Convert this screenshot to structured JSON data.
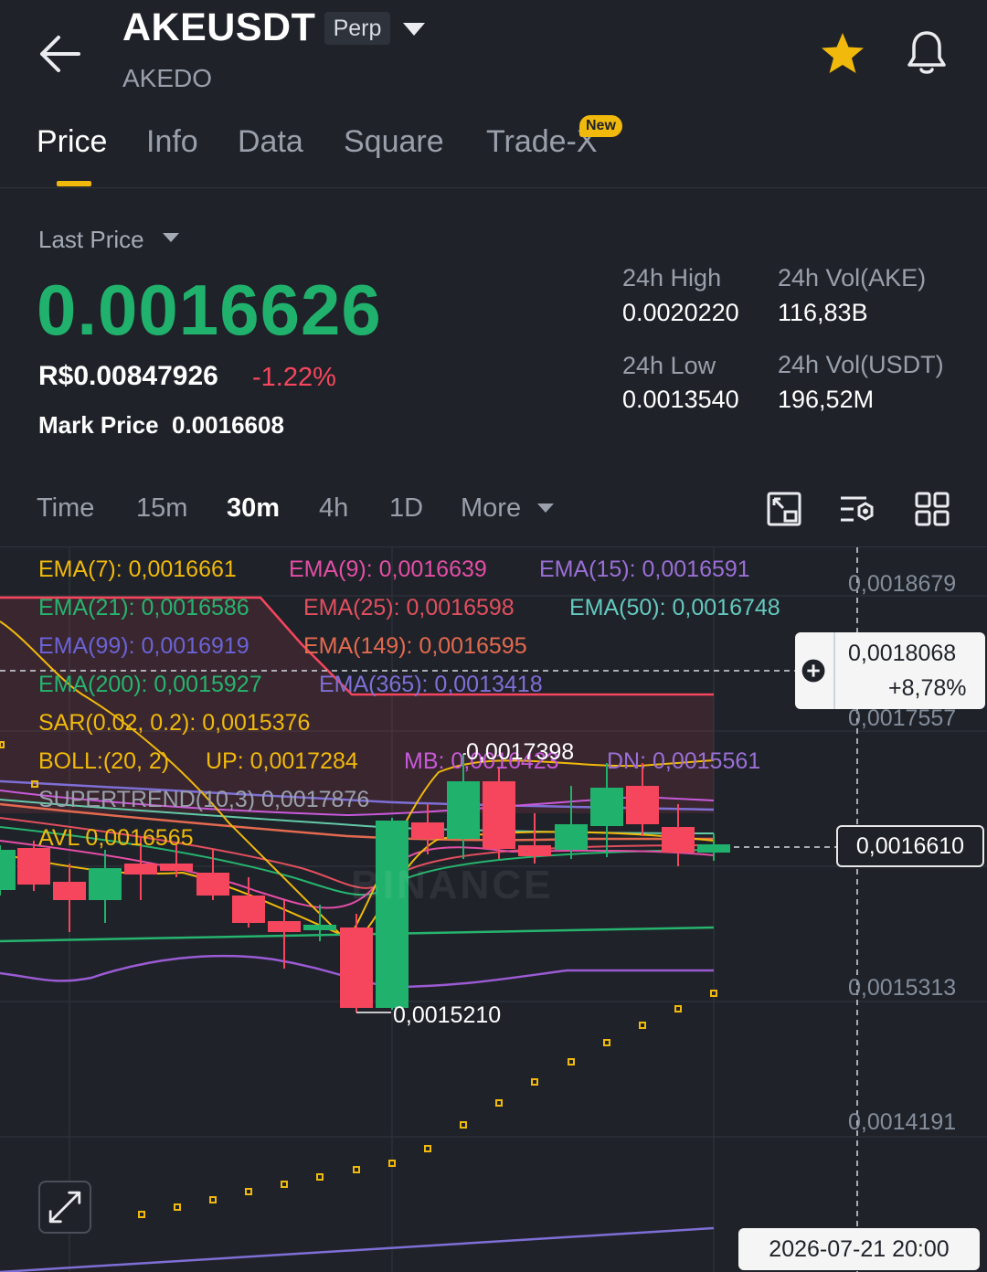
{
  "header": {
    "symbol": "AKEUSDT",
    "contract_type": "Perp",
    "name": "AKEDO"
  },
  "tabs": [
    {
      "label": "Price",
      "active": true
    },
    {
      "label": "Info"
    },
    {
      "label": "Data"
    },
    {
      "label": "Square"
    },
    {
      "label": "Trade-X",
      "badge": "New"
    }
  ],
  "price": {
    "last_price_label": "Last Price",
    "last_price": "0.0016626",
    "fiat_price": "R$0.00847926",
    "change_pct": "-1.22%",
    "mark_price_label": "Mark Price",
    "mark_price": "0.0016608"
  },
  "stats": {
    "high_label": "24h High",
    "high_value": "0.0020220",
    "vol_ake_label": "24h Vol(AKE)",
    "vol_ake_value": "116,83B",
    "low_label": "24h Low",
    "low_value": "0.0013540",
    "vol_usdt_label": "24h Vol(USDT)",
    "vol_usdt_value": "196,52M"
  },
  "intervals": [
    {
      "label": "Time"
    },
    {
      "label": "15m"
    },
    {
      "label": "30m",
      "active": true
    },
    {
      "label": "4h"
    },
    {
      "label": "1D"
    },
    {
      "label": "More"
    }
  ],
  "indicators": {
    "ema7": "EMA(7): 0,0016661",
    "ema9": "EMA(9): 0,0016639",
    "ema15": "EMA(15): 0,0016591",
    "ema21": "EMA(21): 0,0016586",
    "ema25": "EMA(25): 0,0016598",
    "ema50": "EMA(50): 0,0016748",
    "ema99": "EMA(99): 0,0016919",
    "ema149": "EMA(149): 0,0016595",
    "ema200": "EMA(200): 0,0015927",
    "ema365": "EMA(365): 0,0013418",
    "sar": "SAR(0.02, 0.2): 0,0015376",
    "boll": "BOLL:(20, 2)",
    "boll_up": "UP: 0,0017284",
    "boll_mb": "MB: 0,0016423",
    "boll_dn": "DN: 0,0015561",
    "supertrend": "SUPERTREND(10,3) 0,0017876",
    "avl": "AVL 0,0016565"
  },
  "chart": {
    "axis_labels": [
      "0,0018679",
      "0,0017557",
      "0,0015313",
      "0,0014191"
    ],
    "crosshair_price": "0,0018068",
    "crosshair_pct": "+8,78%",
    "current_price": "0,0016610",
    "high_marker": "0,0017398",
    "low_marker": "0,0015210",
    "watermark": "BINANCE",
    "crosshair_time": "2026-07-21 20:00"
  },
  "colors": {
    "up": "#20b26c",
    "down": "#f6465d",
    "accent": "#f0b90b",
    "background": "#1f2229"
  }
}
